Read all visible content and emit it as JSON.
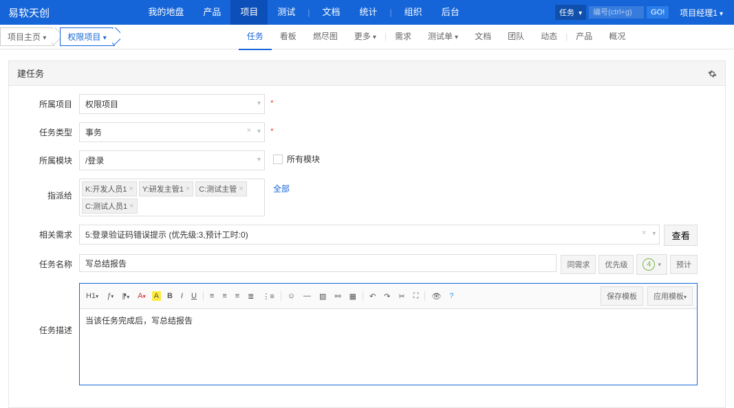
{
  "brand": "易软天创",
  "topnav": {
    "mydisk": "我的地盘",
    "product": "产品",
    "project": "项目",
    "test": "测试",
    "doc": "文档",
    "stats": "统计",
    "org": "组织",
    "admin": "后台"
  },
  "search": {
    "type": "任务",
    "placeholder": "编号(ctrl+g)",
    "go": "GO!"
  },
  "user": "项目经理1",
  "crumbs": {
    "home": "项目主页",
    "proj": "权限项目"
  },
  "subtabs": {
    "task": "任务",
    "kanban": "看板",
    "burn": "燃尽图",
    "more": "更多",
    "demand": "需求",
    "testsheet": "测试单",
    "doc": "文档",
    "team": "团队",
    "dynamic": "动态",
    "product": "产品",
    "overview": "概况"
  },
  "panel_title": "建任务",
  "form": {
    "project_label": "所属项目",
    "project_value": "权限项目",
    "type_label": "任务类型",
    "type_value": "事务",
    "module_label": "所属模块",
    "module_value": "/登录",
    "all_modules": "所有模块",
    "assign_label": "指派给",
    "assignees": [
      "K:开发人员1",
      "Y:研发主管1",
      "C:测试主管",
      "C:测试人员1"
    ],
    "all": "全部",
    "story_label": "相关需求",
    "story_value": "5:登录验证码错误提示 (优先级:3,预计工时:0)",
    "view": "查看",
    "name_label": "任务名称",
    "name_value": "写总结报告",
    "same_story": "同需求",
    "priority": "优先级",
    "pri_value": "4",
    "estimate": "预计",
    "desc_label": "任务描述",
    "desc_value": "当该任务完成后，写总结报告"
  },
  "editor_buttons": {
    "save_tpl": "保存模板",
    "apply_tpl": "应用模板"
  }
}
